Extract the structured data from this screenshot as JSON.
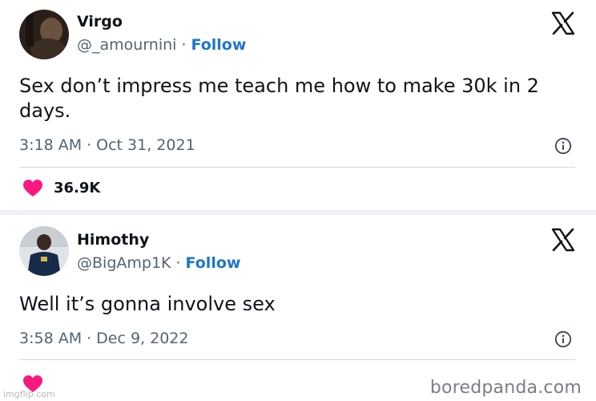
{
  "tweets": [
    {
      "name": "Virgo",
      "handle": "@_amournini",
      "separator": "·",
      "follow": "Follow",
      "text": "Sex don’t impress me teach me how to make 30k in 2 days.",
      "time": "3:18 AM",
      "date": "Oct 31, 2021",
      "likes": "36.9K"
    },
    {
      "name": "Himothy",
      "handle": "@BigAmp1K",
      "separator": "·",
      "follow": "Follow",
      "text": "Well it’s gonna involve sex",
      "time": "3:58 AM",
      "date": "Dec 9, 2022"
    }
  ],
  "watermarks": {
    "imgflip": "imgflip.com",
    "source": "boredpanda.com"
  },
  "colors": {
    "follow": "#1d77c8",
    "heart": "#f91880",
    "secondary_text": "#536471"
  },
  "icons": [
    "x-logo-icon",
    "info-icon",
    "heart-icon"
  ]
}
